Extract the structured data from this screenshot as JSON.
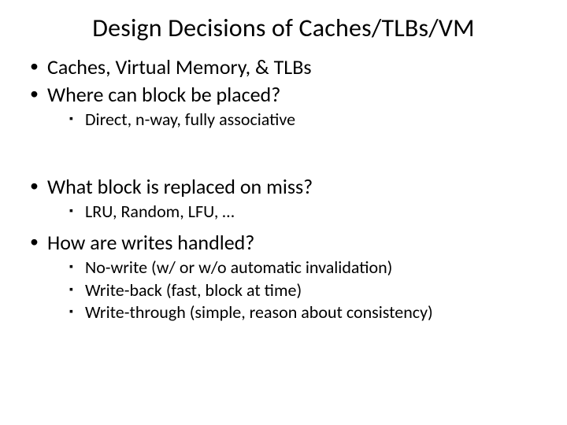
{
  "title": "Design Decisions of Caches/TLBs/VM",
  "bullets": {
    "b1": "Caches, Virtual Memory, & TLBs",
    "b2": "Where can block be placed?",
    "b2_sub1": "Direct, n-way, fully associative",
    "b3": "What block is replaced on miss?",
    "b3_sub1": "LRU, Random, LFU, …",
    "b4": "How are writes handled?",
    "b4_sub1": "No-write (w/ or w/o automatic invalidation)",
    "b4_sub2": "Write-back (fast, block at time)",
    "b4_sub3": "Write-through (simple, reason about consistency)"
  }
}
